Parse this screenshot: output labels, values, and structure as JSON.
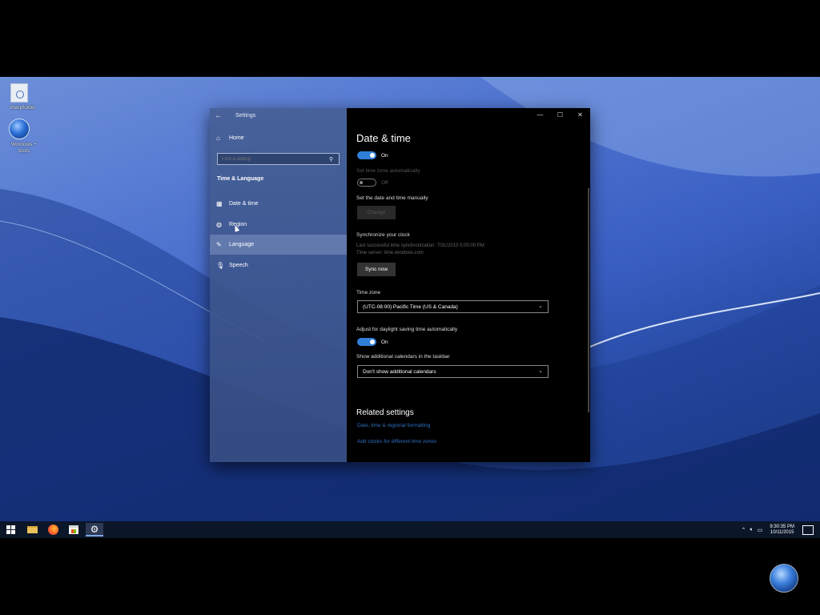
{
  "desktop": {
    "icons": [
      {
        "label": "sharpfolder",
        "type": "doc"
      },
      {
        "label": "Windows + tools",
        "type": "globe"
      }
    ]
  },
  "window": {
    "title": "Settings",
    "controls": {
      "minimize": "—",
      "maximize": "☐",
      "close": "✕"
    }
  },
  "sidebar": {
    "home_label": "Home",
    "search_placeholder": "Find a setting",
    "section_title": "Time & Language",
    "items": [
      {
        "label": "Date & time",
        "icon": "calendar-icon"
      },
      {
        "label": "Region",
        "icon": "globe-icon"
      },
      {
        "label": "Language",
        "icon": "language-icon",
        "selected": true
      },
      {
        "label": "Speech",
        "icon": "microphone-icon"
      }
    ]
  },
  "content": {
    "page_title": "Date & time",
    "set_time_auto_state": "On",
    "set_timezone_auto_label": "Set time zone automatically",
    "set_timezone_auto_state": "Off",
    "set_manual_label": "Set the date and time manually",
    "change_button": "Change",
    "sync_title": "Synchronize your clock",
    "last_sync": "Last successful time synchronization: 7/31/2015 5:00:00 PM",
    "time_server": "Time server: time.windows.com",
    "sync_button": "Sync now",
    "time_zone_label": "Time zone",
    "time_zone_value": "(UTC-08:00) Pacific Time (US & Canada)",
    "dst_label": "Adjust for daylight saving time automatically",
    "dst_state": "On",
    "calendars_label": "Show additional calendars in the taskbar",
    "calendars_value": "Don't show additional calendars",
    "related_title": "Related settings",
    "related_links": [
      "Date, time & regional formatting",
      "Add clocks for different time zones"
    ]
  },
  "taskbar": {
    "clock_time": "9:30:35 PM",
    "clock_date": "10/11/2015"
  }
}
